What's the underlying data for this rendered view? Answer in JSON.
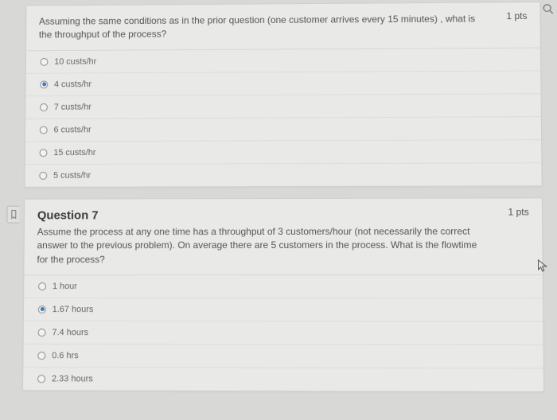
{
  "q6": {
    "points": "1 pts",
    "text": "Assuming the same conditions as in the prior question (one customer arrives every 15 minutes) , what is the throughput of the process?",
    "options": [
      {
        "label": "10 custs/hr",
        "selected": false
      },
      {
        "label": "4 custs/hr",
        "selected": true
      },
      {
        "label": "7 custs/hr",
        "selected": false
      },
      {
        "label": "6 custs/hr",
        "selected": false
      },
      {
        "label": "15 custs/hr",
        "selected": false
      },
      {
        "label": "5 custs/hr",
        "selected": false
      }
    ]
  },
  "q7": {
    "title": "Question 7",
    "points": "1 pts",
    "text": "Assume the process at any one time has a throughput of 3 customers/hour (not necessarily the correct answer to the previous problem). On average there are 5 customers in the process. What is the flowtime for the process?",
    "options": [
      {
        "label": "1 hour",
        "selected": false
      },
      {
        "label": "1.67 hours",
        "selected": true
      },
      {
        "label": "7.4 hours",
        "selected": false
      },
      {
        "label": "0.6 hrs",
        "selected": false
      },
      {
        "label": "2.33 hours",
        "selected": false
      }
    ]
  }
}
